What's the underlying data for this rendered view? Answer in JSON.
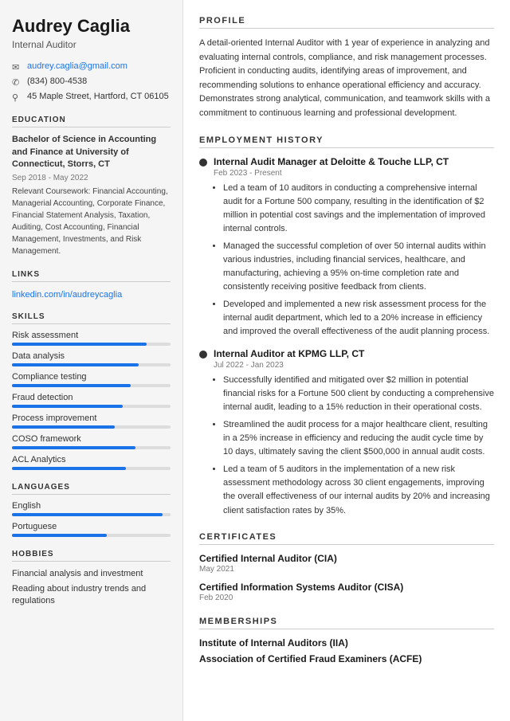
{
  "sidebar": {
    "name": "Audrey Caglia",
    "title": "Internal Auditor",
    "contact": {
      "email": "audrey.caglia@gmail.com",
      "phone": "(834) 800-4538",
      "address": "45 Maple Street, Hartford, CT 06105"
    },
    "education": {
      "section_title": "EDUCATION",
      "degree": "Bachelor of Science in Accounting and Finance at University of Connecticut, Storrs, CT",
      "dates": "Sep 2018 - May 2022",
      "courses_label": "Relevant Coursework:",
      "courses": "Financial Accounting, Managerial Accounting, Corporate Finance, Financial Statement Analysis, Taxation, Auditing, Cost Accounting, Financial Management, Investments, and Risk Management."
    },
    "links": {
      "section_title": "LINKS",
      "linkedin": "linkedin.com/in/audreycaglia",
      "linkedin_href": "https://linkedin.com/in/audreycaglia"
    },
    "skills": {
      "section_title": "SKILLS",
      "items": [
        {
          "name": "Risk assessment",
          "pct": 85
        },
        {
          "name": "Data analysis",
          "pct": 80
        },
        {
          "name": "Compliance testing",
          "pct": 75
        },
        {
          "name": "Fraud detection",
          "pct": 70
        },
        {
          "name": "Process improvement",
          "pct": 65
        },
        {
          "name": "COSO framework",
          "pct": 78
        },
        {
          "name": "ACL Analytics",
          "pct": 72
        }
      ]
    },
    "languages": {
      "section_title": "LANGUAGES",
      "items": [
        {
          "name": "English",
          "pct": 95
        },
        {
          "name": "Portuguese",
          "pct": 60
        }
      ]
    },
    "hobbies": {
      "section_title": "HOBBIES",
      "items": [
        "Financial analysis and investment",
        "Reading about industry trends and regulations"
      ]
    }
  },
  "main": {
    "profile": {
      "section_title": "PROFILE",
      "text": "A detail-oriented Internal Auditor with 1 year of experience in analyzing and evaluating internal controls, compliance, and risk management processes. Proficient in conducting audits, identifying areas of improvement, and recommending solutions to enhance operational efficiency and accuracy. Demonstrates strong analytical, communication, and teamwork skills with a commitment to continuous learning and professional development."
    },
    "employment": {
      "section_title": "EMPLOYMENT HISTORY",
      "jobs": [
        {
          "title": "Internal Audit Manager at Deloitte & Touche LLP, CT",
          "dates": "Feb 2023 - Present",
          "bullets": [
            "Led a team of 10 auditors in conducting a comprehensive internal audit for a Fortune 500 company, resulting in the identification of $2 million in potential cost savings and the implementation of improved internal controls.",
            "Managed the successful completion of over 50 internal audits within various industries, including financial services, healthcare, and manufacturing, achieving a 95% on-time completion rate and consistently receiving positive feedback from clients.",
            "Developed and implemented a new risk assessment process for the internal audit department, which led to a 20% increase in efficiency and improved the overall effectiveness of the audit planning process."
          ]
        },
        {
          "title": "Internal Auditor at KPMG LLP, CT",
          "dates": "Jul 2022 - Jan 2023",
          "bullets": [
            "Successfully identified and mitigated over $2 million in potential financial risks for a Fortune 500 client by conducting a comprehensive internal audit, leading to a 15% reduction in their operational costs.",
            "Streamlined the audit process for a major healthcare client, resulting in a 25% increase in efficiency and reducing the audit cycle time by 10 days, ultimately saving the client $500,000 in annual audit costs.",
            "Led a team of 5 auditors in the implementation of a new risk assessment methodology across 30 client engagements, improving the overall effectiveness of our internal audits by 20% and increasing client satisfaction rates by 35%."
          ]
        }
      ]
    },
    "certificates": {
      "section_title": "CERTIFICATES",
      "items": [
        {
          "name": "Certified Internal Auditor (CIA)",
          "date": "May 2021"
        },
        {
          "name": "Certified Information Systems Auditor (CISA)",
          "date": "Feb 2020"
        }
      ]
    },
    "memberships": {
      "section_title": "MEMBERSHIPS",
      "items": [
        "Institute of Internal Auditors (IIA)",
        "Association of Certified Fraud Examiners (ACFE)"
      ]
    }
  }
}
